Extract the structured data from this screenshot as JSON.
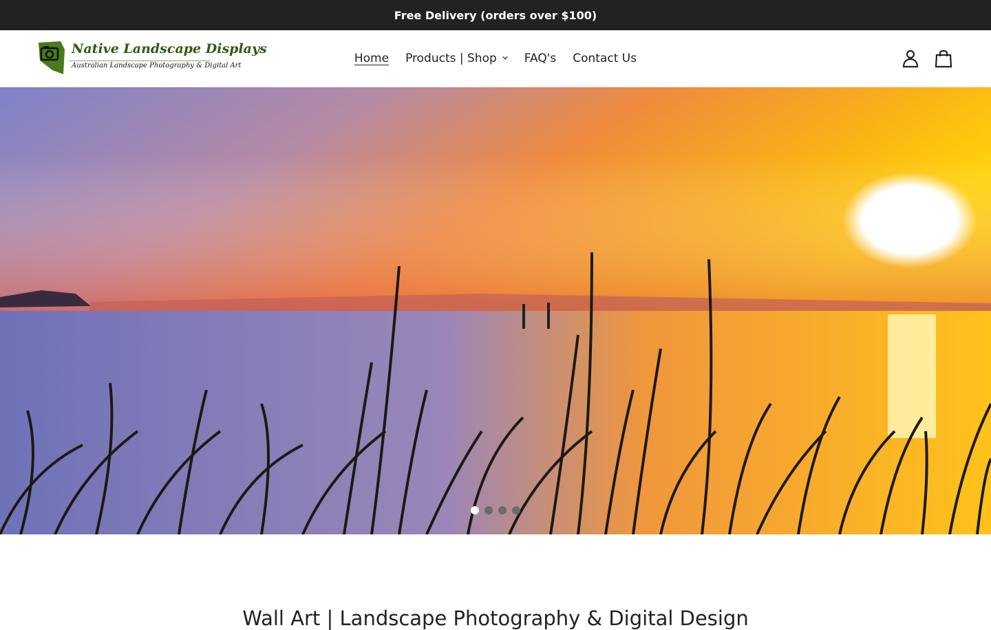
{
  "announcement": {
    "text": "Free Delivery (orders over $100)"
  },
  "brand": {
    "name": "Native Landscape Displays",
    "tagline": "Australian Landscape Photography & Digital Art"
  },
  "nav": {
    "items": [
      {
        "label": "Home",
        "active": true
      },
      {
        "label": "Products | Shop",
        "dropdown": true
      },
      {
        "label": "FAQ's"
      },
      {
        "label": "Contact Us"
      }
    ]
  },
  "header_icons": [
    "account-icon",
    "cart-icon"
  ],
  "slideshow": {
    "slide_count": 4,
    "active_slide": 1,
    "dots": [
      "",
      "",
      "",
      ""
    ]
  },
  "section": {
    "title": "Wall Art | Landscape Photography & Digital Design"
  },
  "colors": {
    "announcement_bg": "#222222",
    "logo_green": "#2e5a10",
    "text": "#222222"
  }
}
